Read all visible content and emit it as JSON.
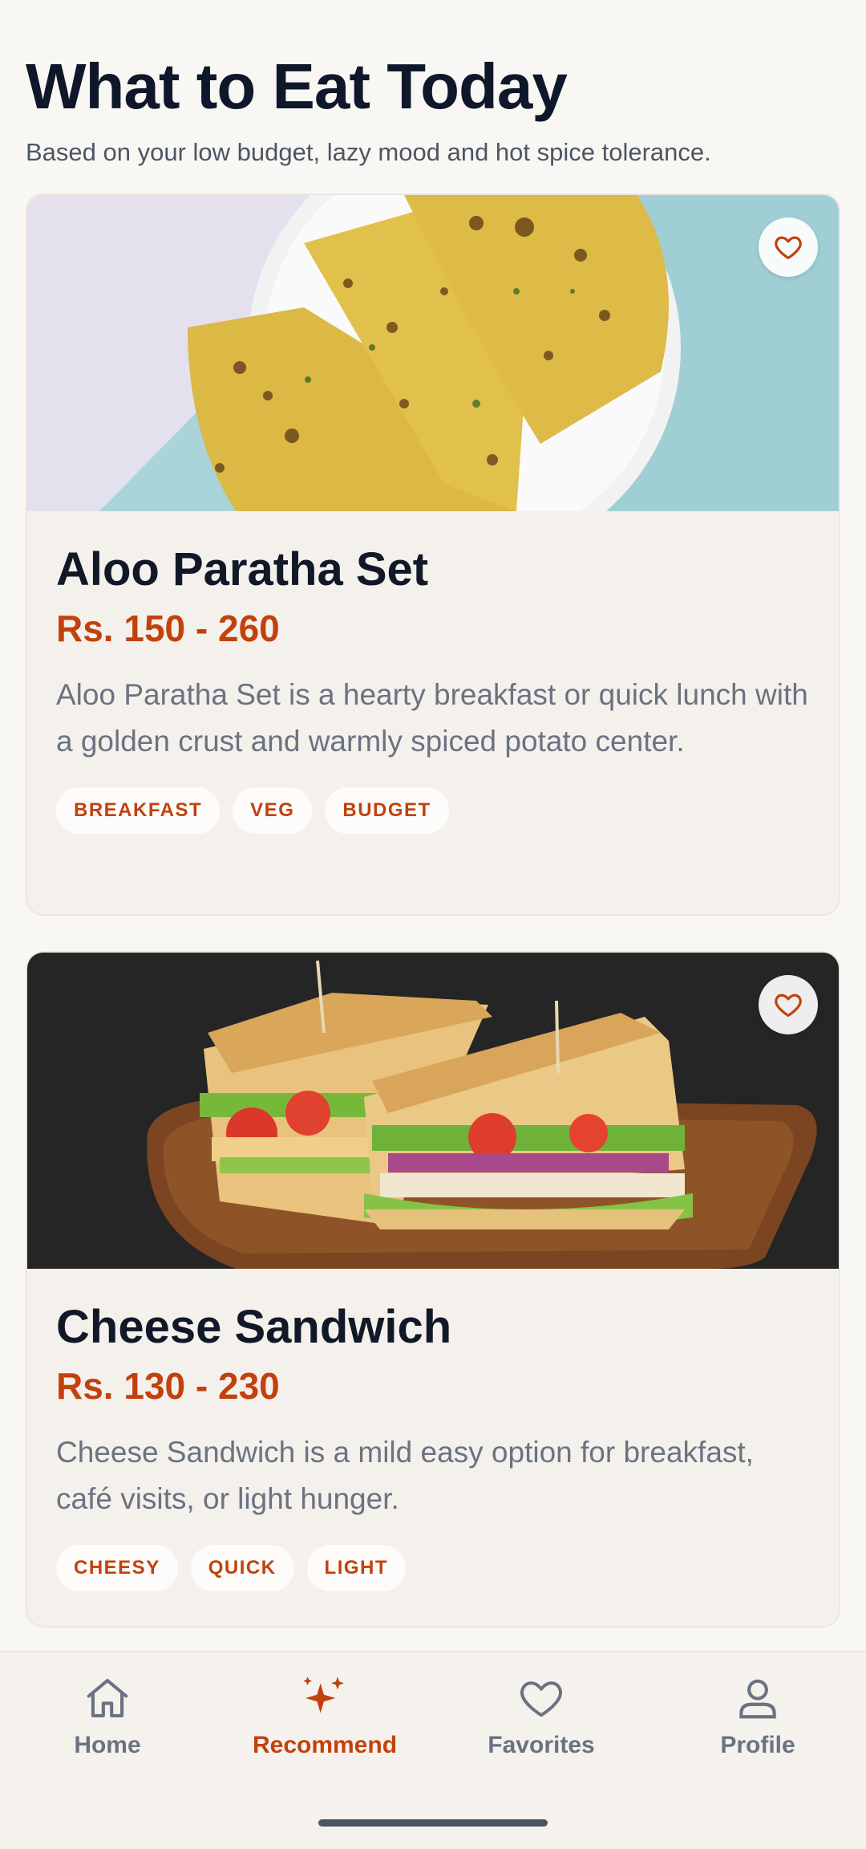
{
  "header": {
    "title": "What to Eat Today",
    "subtitle": "Based on your low budget, lazy mood and hot spice tolerance."
  },
  "cards": [
    {
      "name": "Aloo Paratha Set",
      "price": "Rs. 150 - 260",
      "description": "Aloo Paratha Set is a hearty breakfast or quick lunch with a golden crust and warmly spiced potato center.",
      "tags": [
        "BREAKFAST",
        "VEG",
        "BUDGET"
      ],
      "image": "aloo-paratha-photo",
      "favorite_icon": "heart-outline-icon"
    },
    {
      "name": "Cheese Sandwich",
      "price": "Rs. 130 - 230",
      "description": "Cheese Sandwich is a mild easy option for breakfast, café visits, or light hunger.",
      "tags": [
        "CHEESY",
        "QUICK",
        "LIGHT"
      ],
      "image": "cheese-sandwich-photo",
      "favorite_icon": "heart-outline-icon"
    }
  ],
  "nav": {
    "items": [
      {
        "label": "Home",
        "icon": "home-icon",
        "active": false
      },
      {
        "label": "Recommend",
        "icon": "sparkle-icon",
        "active": true
      },
      {
        "label": "Favorites",
        "icon": "heart-icon",
        "active": false
      },
      {
        "label": "Profile",
        "icon": "user-icon",
        "active": false
      }
    ]
  },
  "colors": {
    "accent": "#c2410c",
    "background": "#f9f7f4",
    "card": "#f4f1ec",
    "text": "#111827",
    "muted": "#6b7280"
  }
}
